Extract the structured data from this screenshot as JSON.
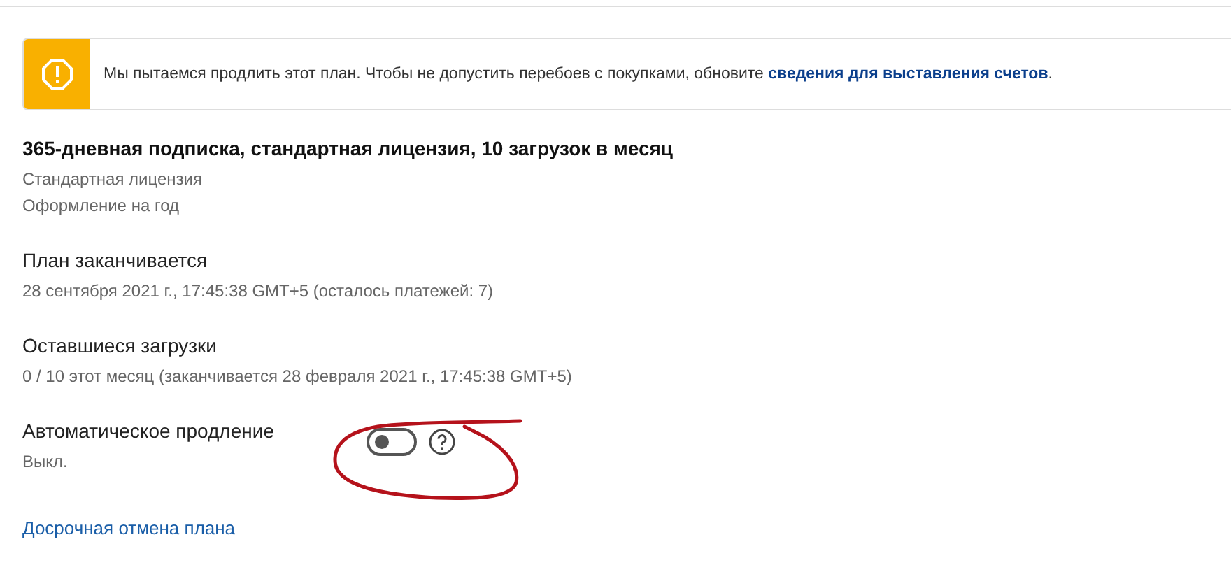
{
  "banner": {
    "kind": "warning",
    "text": "Мы пытаемся продлить этот план. Чтобы не допустить перебоев с покупками, обновите ",
    "link": "сведения для выставления счетов",
    "text_end": "."
  },
  "plan": {
    "title": "365-дневная подписка, стандартная лицензия, 10 загрузок в месяц",
    "lines": [
      "Стандартная лицензия",
      "Оформление на год"
    ]
  },
  "sections": [
    {
      "label": "План заканчивается",
      "value": "28 сентября 2021 г., 17:45:38 GMT+5 (осталось платежей: 7)"
    },
    {
      "label": "Оставшиеся загрузки",
      "value": "0 / 10 этот месяц (заканчивается 28 февраля 2021 г., 17:45:38 GMT+5)"
    }
  ],
  "auto_renew": {
    "label": "Автоматическое продление",
    "value": "Выкл.",
    "on": false
  },
  "cancel_link": "Досрочная отмена плана"
}
